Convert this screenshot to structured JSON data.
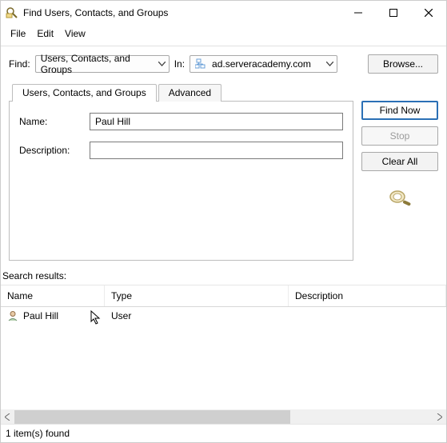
{
  "window": {
    "title": "Find Users, Contacts, and Groups"
  },
  "menu": {
    "file": "File",
    "edit": "Edit",
    "view": "View"
  },
  "find": {
    "label": "Find:",
    "combo_value": "Users, Contacts, and Groups",
    "in_label": "In:",
    "in_value": "ad.serveracademy.com",
    "browse": "Browse..."
  },
  "tabs": {
    "ucg": "Users, Contacts, and Groups",
    "advanced": "Advanced"
  },
  "form": {
    "name_label": "Name:",
    "name_value": "Paul Hill",
    "desc_label": "Description:",
    "desc_value": ""
  },
  "actions": {
    "find_now": "Find Now",
    "stop": "Stop",
    "clear_all": "Clear All"
  },
  "results": {
    "label": "Search results:",
    "columns": {
      "name": "Name",
      "type": "Type",
      "desc": "Description"
    },
    "rows": [
      {
        "name": "Paul Hill",
        "type": "User",
        "desc": ""
      }
    ]
  },
  "status": {
    "text": "1 item(s) found"
  }
}
